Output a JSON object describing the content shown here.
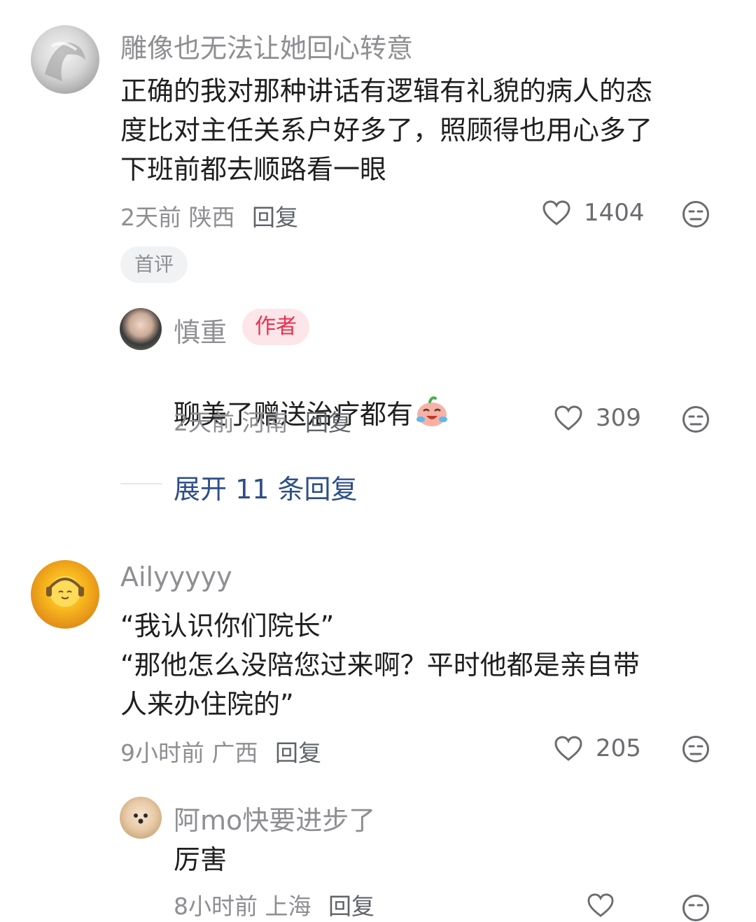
{
  "comments": [
    {
      "username": "雕像也无法让她回心转意",
      "text": "正确的我对那种讲话有逻辑有礼貌的病人的态\n度比对主任关系户好多了，照顾得也用心多了\n下班前都去顺路看一眼",
      "time": "2天前",
      "region": "陕西",
      "reply_label": "回复",
      "likes": "1404",
      "badge": "首评"
    },
    {
      "username": "Ailyyyyy",
      "text": "“我认识你们院长”\n“那他怎么没陪您过来啊？平时他都是亲自带\n人来办住院的”",
      "time": "9小时前",
      "region": "广西",
      "reply_label": "回复",
      "likes": "205"
    }
  ],
  "replies": [
    {
      "username": "慎重",
      "author_tag": "作者",
      "text": "聊美了赠送治疗都有",
      "time": "2天前",
      "region": "河南",
      "reply_label": "回复",
      "likes": "309"
    },
    {
      "username": "阿mo快要进步了",
      "text": "厉害",
      "time": "8小时前",
      "region": "上海",
      "reply_label": "回复"
    }
  ],
  "expand_label": "展开 11 条回复",
  "icons": {
    "like": "heart-outline-icon",
    "dislike": "meh-face-icon",
    "emoji": "crying-laughing-peach-emoji"
  },
  "colors": {
    "username": "#8e8e93",
    "text": "#1f1f1f",
    "author_tag": "#e8304f",
    "expand": "#2f4f86"
  }
}
